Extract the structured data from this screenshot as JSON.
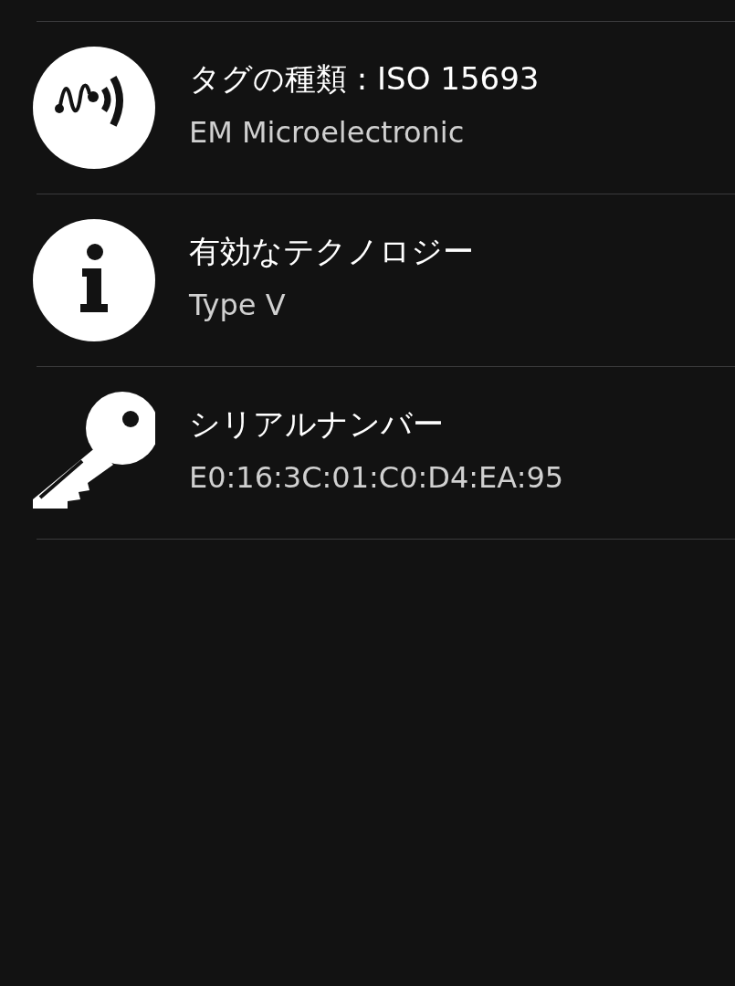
{
  "rows": [
    {
      "kind": "nfc",
      "title": "タグの種類 : ISO 15693",
      "detail": "EM Microelectronic"
    },
    {
      "kind": "info",
      "title": "有効なテクノロジー",
      "detail": "Type V"
    },
    {
      "kind": "key",
      "title": "シリアルナンバー",
      "detail": "E0:16:3C:01:C0:D4:EA:95"
    }
  ]
}
